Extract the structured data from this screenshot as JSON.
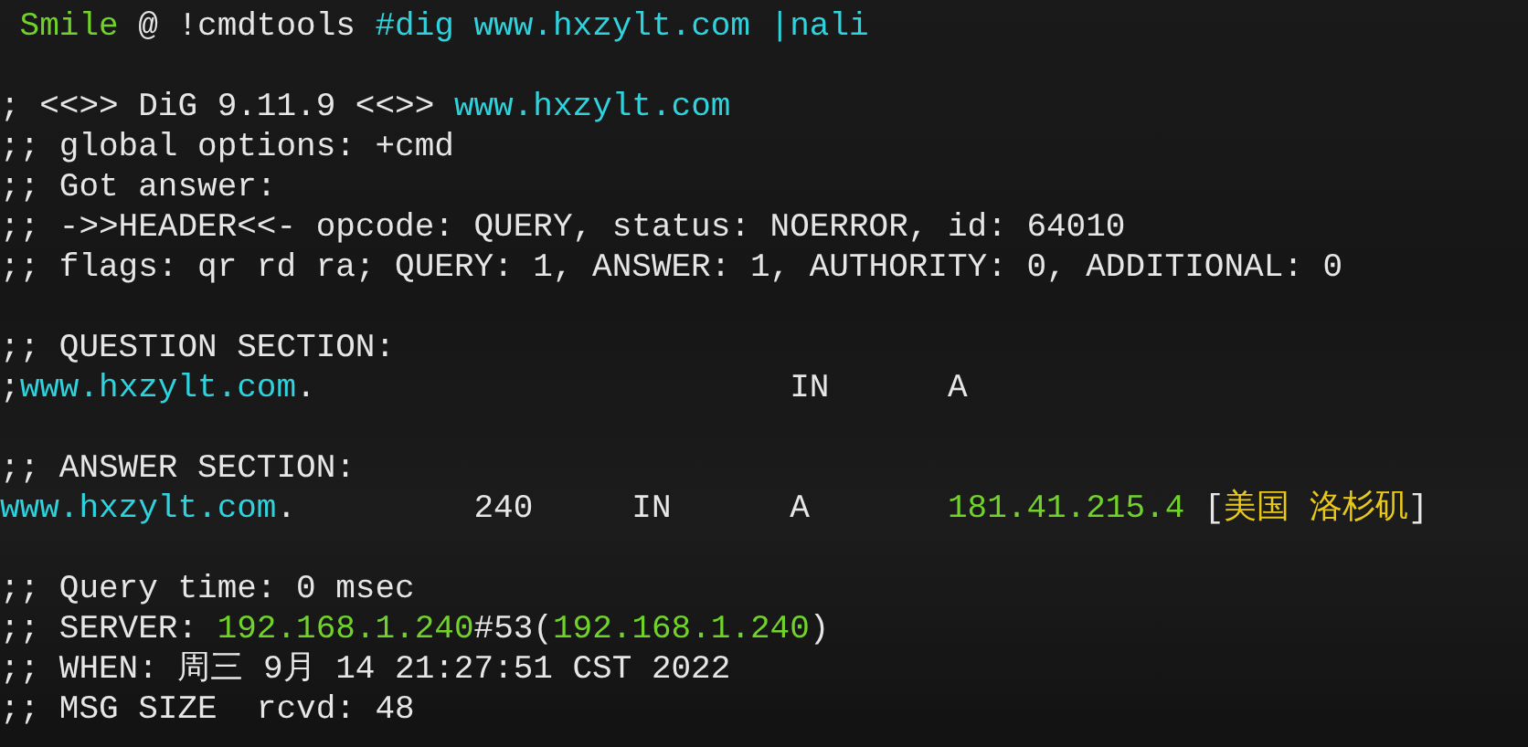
{
  "terminal": {
    "blocks": [
      {
        "lines": [
          {
            "segments": [
              {
                "text": " Smile",
                "color": "#72d22c"
              },
              {
                "text": " @ !cmdtools ",
                "color": "#e6e6e6"
              },
              {
                "text": "#dig www.hxzylt.com |nali",
                "color": "#2fd3de"
              }
            ]
          }
        ]
      },
      {
        "lines": [
          {
            "segments": [
              {
                "text": "; <<>> DiG 9.11.9 <<>> ",
                "color": "#e6e6e6"
              },
              {
                "text": "www.hxzylt.com",
                "color": "#2fd3de"
              }
            ]
          },
          {
            "segments": [
              {
                "text": ";; global options: +cmd",
                "color": "#e6e6e6"
              }
            ]
          },
          {
            "segments": [
              {
                "text": ";; Got answer:",
                "color": "#e6e6e6"
              }
            ]
          },
          {
            "segments": [
              {
                "text": ";; ->>HEADER<<- opcode: QUERY, status: NOERROR, id: 64010",
                "color": "#e6e6e6"
              }
            ]
          },
          {
            "segments": [
              {
                "text": ";; flags: qr rd ra; QUERY: 1, ANSWER: 1, AUTHORITY: 0, ADDITIONAL: 0",
                "color": "#e6e6e6"
              }
            ]
          }
        ]
      },
      {
        "lines": [
          {
            "segments": [
              {
                "text": ";; QUESTION SECTION:",
                "color": "#e6e6e6"
              }
            ]
          },
          {
            "segments": [
              {
                "text": ";",
                "color": "#e6e6e6"
              },
              {
                "text": "www.hxzylt.com",
                "color": "#2fd3de"
              },
              {
                "text": ".                        IN      A",
                "color": "#e6e6e6"
              }
            ]
          }
        ]
      },
      {
        "lines": [
          {
            "segments": [
              {
                "text": ";; ANSWER SECTION:",
                "color": "#e6e6e6"
              }
            ]
          },
          {
            "segments": [
              {
                "text": "www.hxzylt.com",
                "color": "#2fd3de"
              },
              {
                "text": ".         240     IN      A       ",
                "color": "#e6e6e6"
              },
              {
                "text": "181.41.215.4",
                "color": "#72d22c"
              },
              {
                "text": " [",
                "color": "#e6e6e6"
              },
              {
                "text": "美国 洛杉矶",
                "color": "#e8c81a"
              },
              {
                "text": "]",
                "color": "#e6e6e6"
              }
            ]
          }
        ]
      },
      {
        "lines": [
          {
            "segments": [
              {
                "text": ";; Query time: 0 msec",
                "color": "#e6e6e6"
              }
            ]
          },
          {
            "segments": [
              {
                "text": ";; SERVER: ",
                "color": "#e6e6e6"
              },
              {
                "text": "192.168.1.240",
                "color": "#72d22c"
              },
              {
                "text": "#53(",
                "color": "#e6e6e6"
              },
              {
                "text": "192.168.1.240",
                "color": "#72d22c"
              },
              {
                "text": ")",
                "color": "#e6e6e6"
              }
            ]
          },
          {
            "segments": [
              {
                "text": ";; WHEN: 周三 9月 14 21:27:51 CST 2022",
                "color": "#e6e6e6"
              }
            ]
          },
          {
            "segments": [
              {
                "text": ";; MSG SIZE  rcvd: 48",
                "color": "#e6e6e6"
              }
            ]
          }
        ]
      }
    ]
  }
}
